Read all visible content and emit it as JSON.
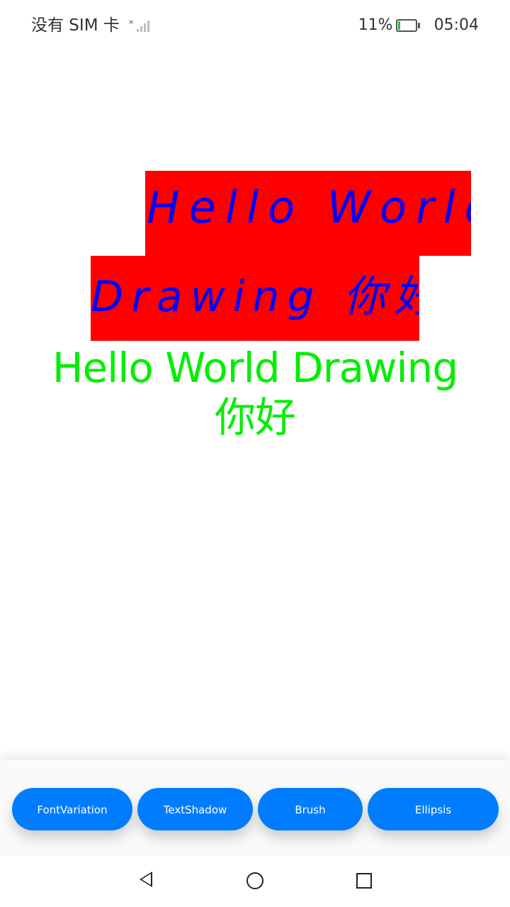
{
  "status_bar": {
    "carrier": "没有 SIM 卡",
    "battery_percent": "11%",
    "time": "05:04",
    "battery_level": 0.11
  },
  "drawing": {
    "line1": "Hello World",
    "line2": "Drawing 你好",
    "green_line1": "Hello World Drawing",
    "green_line2": "你好",
    "colors": {
      "highlight_background": "#ff0000",
      "styled_text": "#0000ff",
      "plain_text": "#00ee00"
    }
  },
  "toolbar": {
    "buttons": [
      {
        "label": "FontVariation"
      },
      {
        "label": "TextShadow"
      },
      {
        "label": "Brush"
      },
      {
        "label": "Ellipsis"
      }
    ],
    "accent": "#007dff"
  },
  "nav_bar": {
    "icons": [
      "back-icon",
      "home-icon",
      "recent-apps-icon"
    ]
  }
}
